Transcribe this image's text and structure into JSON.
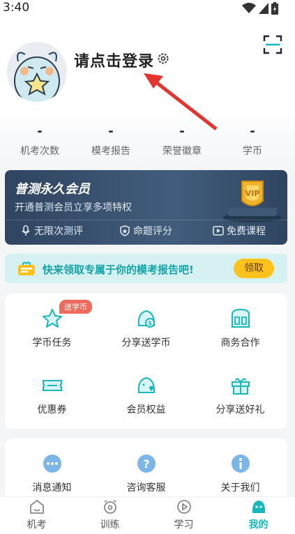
{
  "status_bar": {
    "time": "3:40"
  },
  "header": {
    "login_prompt": "请点击登录"
  },
  "stats": [
    {
      "value": "-",
      "label": "机考次数"
    },
    {
      "value": "-",
      "label": "模考报告"
    },
    {
      "value": "-",
      "label": "荣誉徽章"
    },
    {
      "value": "-",
      "label": "学币"
    }
  ],
  "vip": {
    "title": "普测永久会员",
    "subtitle": "开通普测会员立享多项特权",
    "features": [
      "无限次测评",
      "命题评分",
      "免费课程"
    ]
  },
  "promo": {
    "text": "快来领取专属于你的模考报告吧!",
    "button": "领取"
  },
  "grid": {
    "badge": "送学币",
    "items": [
      "学币任务",
      "分享送学币",
      "商务合作",
      "优惠券",
      "会员权益",
      "分享送好礼"
    ]
  },
  "service": {
    "items": [
      "消息通知",
      "咨询客服",
      "关于我们"
    ]
  },
  "tabbar": {
    "items": [
      "机考",
      "训练",
      "学习",
      "我的"
    ],
    "active": "我的"
  },
  "colors": {
    "accent": "#16b8be",
    "vip_bg": "#2f4561",
    "promo_bg": "#d5f1f2",
    "button_yellow": "#ffc21a"
  }
}
